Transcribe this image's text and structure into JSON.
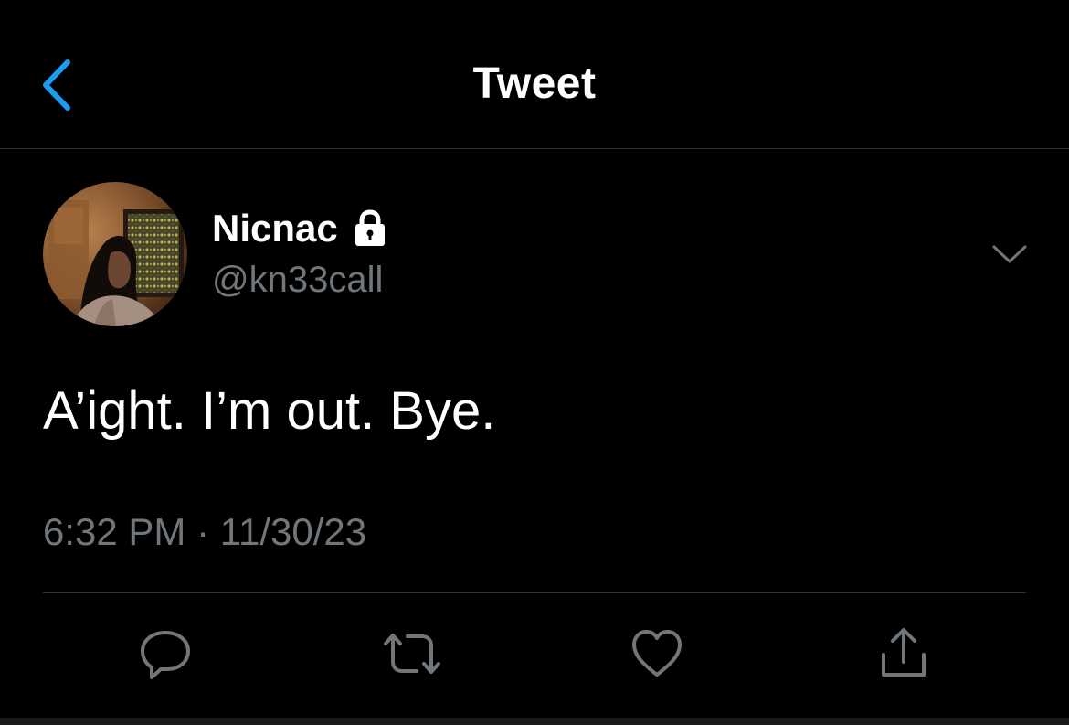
{
  "colors": {
    "background": "#000000",
    "accent": "#1d9bf0",
    "primary_text": "#ffffff",
    "secondary_text": "#71767b",
    "divider": "#2f3336"
  },
  "header": {
    "title": "Tweet",
    "back_icon": "chevron-left-icon"
  },
  "tweet": {
    "author": {
      "name": "Nicnac",
      "handle": "@kn33call",
      "protected_icon": "lock-icon",
      "avatar": "profile-photo"
    },
    "more_icon": "chevron-down-icon",
    "text": "A’ight. I’m out. Bye.",
    "timestamp": "6:32 PM · 11/30/23"
  },
  "actions": [
    {
      "name": "reply",
      "icon": "reply-icon"
    },
    {
      "name": "retweet",
      "icon": "retweet-icon"
    },
    {
      "name": "like",
      "icon": "heart-icon"
    },
    {
      "name": "share",
      "icon": "share-icon"
    }
  ]
}
